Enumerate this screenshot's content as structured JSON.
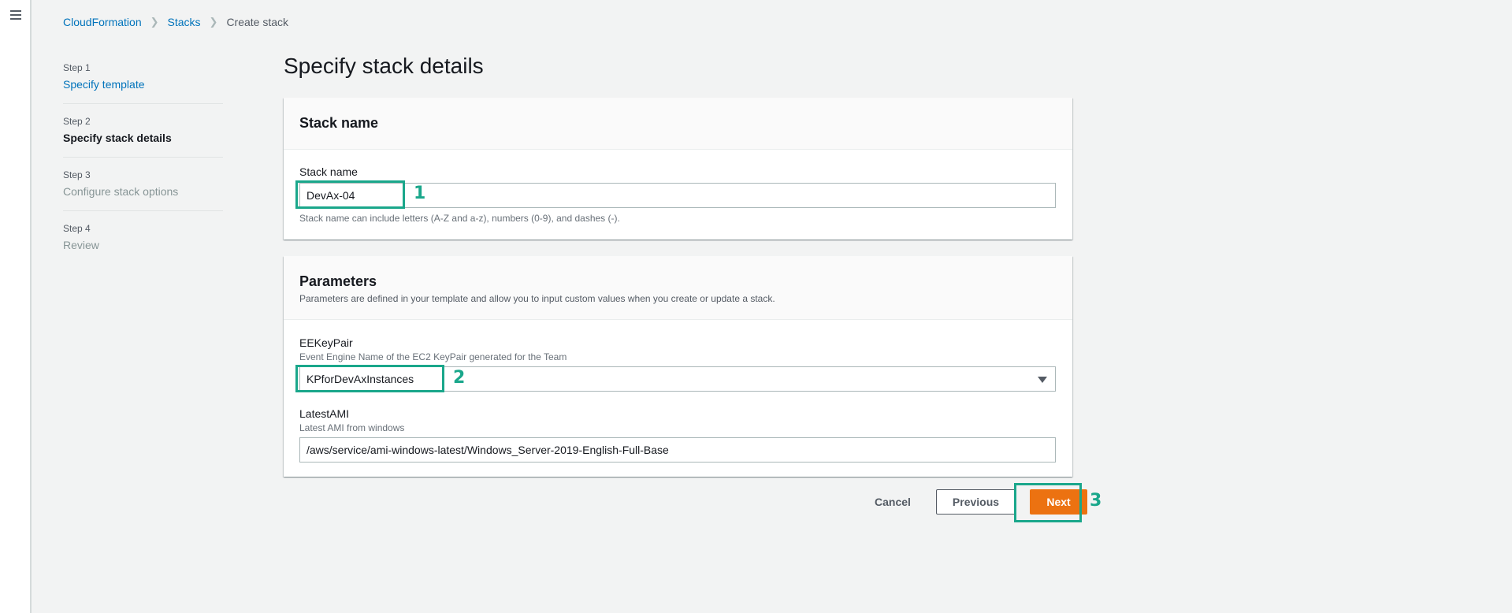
{
  "breadcrumb": [
    {
      "label": "CloudFormation"
    },
    {
      "label": "Stacks"
    },
    {
      "label": "Create stack"
    }
  ],
  "steps": [
    {
      "num": "Step 1",
      "title": "Specify template",
      "state": "link"
    },
    {
      "num": "Step 2",
      "title": "Specify stack details",
      "state": "active"
    },
    {
      "num": "Step 3",
      "title": "Configure stack options",
      "state": "disabled"
    },
    {
      "num": "Step 4",
      "title": "Review",
      "state": "disabled"
    }
  ],
  "page_title": "Specify stack details",
  "stack_name_section": {
    "header": "Stack name",
    "field_label": "Stack name",
    "value": "DevAx-04",
    "hint": "Stack name can include letters (A-Z and a-z), numbers (0-9), and dashes (-)."
  },
  "parameters_section": {
    "header": "Parameters",
    "description": "Parameters are defined in your template and allow you to input custom values when you create or update a stack.",
    "params": [
      {
        "label": "EEKeyPair",
        "description": "Event Engine Name of the EC2 KeyPair generated for the Team",
        "value": "KPforDevAxInstances",
        "type": "select"
      },
      {
        "label": "LatestAMI",
        "description": "Latest AMI from windows",
        "value": "/aws/service/ami-windows-latest/Windows_Server-2019-English-Full-Base",
        "type": "text"
      }
    ]
  },
  "actions": {
    "cancel": "Cancel",
    "previous": "Previous",
    "next": "Next"
  },
  "annotations": [
    "1",
    "2",
    "3"
  ],
  "colors": {
    "link": "#0073bb",
    "primary": "#ec7211",
    "annotation": "#1aa78b"
  }
}
